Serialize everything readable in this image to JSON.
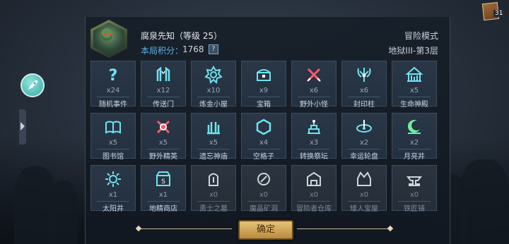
{
  "player": {
    "name": "腐泉先知（等级 25）",
    "score_label": "本局积分：",
    "score_value": "1768",
    "help": "?"
  },
  "mode": {
    "label": "冒险模式",
    "floor": "地狱III-第3层"
  },
  "cards": {
    "count": "31"
  },
  "confirm_label": "确定",
  "accent_colors": {
    "icon": "#6fe3f0",
    "score_label": "#5fb3e6",
    "button": "#d9b066"
  },
  "items": [
    {
      "label": "随机事件",
      "count": "x24",
      "icon": "question-icon"
    },
    {
      "label": "传送门",
      "count": "x12",
      "icon": "portal-icon"
    },
    {
      "label": "炼金小屋",
      "count": "x10",
      "icon": "alchemy-icon"
    },
    {
      "label": "宝箱",
      "count": "x9",
      "icon": "chest-icon"
    },
    {
      "label": "野外小怪",
      "count": "x6",
      "icon": "crossed-swords-icon"
    },
    {
      "label": "封印柱",
      "count": "x6",
      "icon": "seal-pillar-icon"
    },
    {
      "label": "生命神殿",
      "count": "x5",
      "icon": "temple-icon"
    },
    {
      "label": "图书馆",
      "count": "x5",
      "icon": "book-icon"
    },
    {
      "label": "野外精英",
      "count": "x5",
      "icon": "elite-icon"
    },
    {
      "label": "遗忘神庙",
      "count": "x5",
      "icon": "forgotten-temple-icon"
    },
    {
      "label": "空格子",
      "count": "x4",
      "icon": "hexagon-icon"
    },
    {
      "label": "转换祭坛",
      "count": "x3",
      "icon": "altar-icon"
    },
    {
      "label": "幸运轮盘",
      "count": "x2",
      "icon": "roulette-icon"
    },
    {
      "label": "月亮井",
      "count": "x2",
      "icon": "moon-icon"
    },
    {
      "label": "太阳井",
      "count": "x1",
      "icon": "sun-icon"
    },
    {
      "label": "地精商店",
      "count": "x1",
      "icon": "shop-icon"
    },
    {
      "label": "勇士之墓",
      "count": "x0",
      "icon": "tomb-icon"
    },
    {
      "label": "魔晶矿洞",
      "count": "x0",
      "icon": "mine-icon"
    },
    {
      "label": "冒险者仓库",
      "count": "x0",
      "icon": "warehouse-icon"
    },
    {
      "label": "矮人宝屋",
      "count": "x0",
      "icon": "dwarf-house-icon"
    },
    {
      "label": "铁匠铺",
      "count": "x0",
      "icon": "anvil-icon"
    }
  ]
}
